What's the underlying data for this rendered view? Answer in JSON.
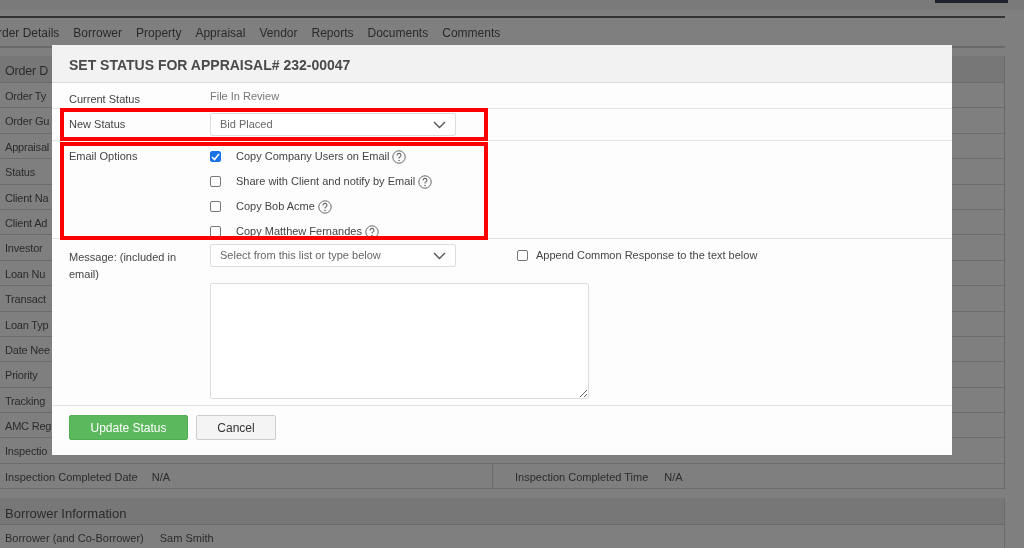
{
  "nav_tabs": [
    {
      "label": "rder Details"
    },
    {
      "label": "Borrower"
    },
    {
      "label": "Property"
    },
    {
      "label": "Appraisal"
    },
    {
      "label": "Vendor"
    },
    {
      "label": "Reports"
    },
    {
      "label": "Documents"
    },
    {
      "label": "Comments"
    }
  ],
  "order_panel": {
    "title": "Order D",
    "rows": [
      "Order Ty",
      "Order Gu",
      "Appraisal",
      "Status",
      "Client Na",
      "Client Ad",
      "Investor",
      "Loan Nu",
      "Transact",
      "Loan Typ",
      "Date Nee",
      "Priority",
      "Tracking",
      "AMC Reg",
      "Inspectio"
    ],
    "inspection_row": {
      "label": "Inspection Completed Date",
      "value": "N/A",
      "label_2": "Inspection Completed Time",
      "value_2": "N/A"
    }
  },
  "borrower_panel": {
    "title": "Borrower Information",
    "rows": [
      {
        "label": "Borrower (and Co-Borrower)",
        "value": "Sam Smith"
      }
    ]
  },
  "modal": {
    "title": "SET STATUS FOR APPRAISAL# 232-00047",
    "current_status": {
      "label": "Current Status",
      "value": "File In Review"
    },
    "new_status": {
      "label": "New Status",
      "value": "Bid Placed",
      "highlighted": true
    },
    "email_options": {
      "label": "Email Options",
      "highlighted": true,
      "options": [
        {
          "label": "Copy Company Users on Email",
          "checked": true
        },
        {
          "label": "Share with Client and notify by Email",
          "checked": false
        },
        {
          "label": "Copy Bob Acme",
          "checked": false
        },
        {
          "label": "Copy Matthew Fernandes",
          "checked": false
        }
      ]
    },
    "message": {
      "label": "Message: (included in email)",
      "placeholder": "Select from this list or type below",
      "append": {
        "label": "Append Common Response to the text below",
        "checked": false
      }
    },
    "buttons": [
      {
        "label": "Update Status",
        "kind": "primary"
      },
      {
        "label": "Cancel",
        "kind": "secondary"
      }
    ]
  }
}
